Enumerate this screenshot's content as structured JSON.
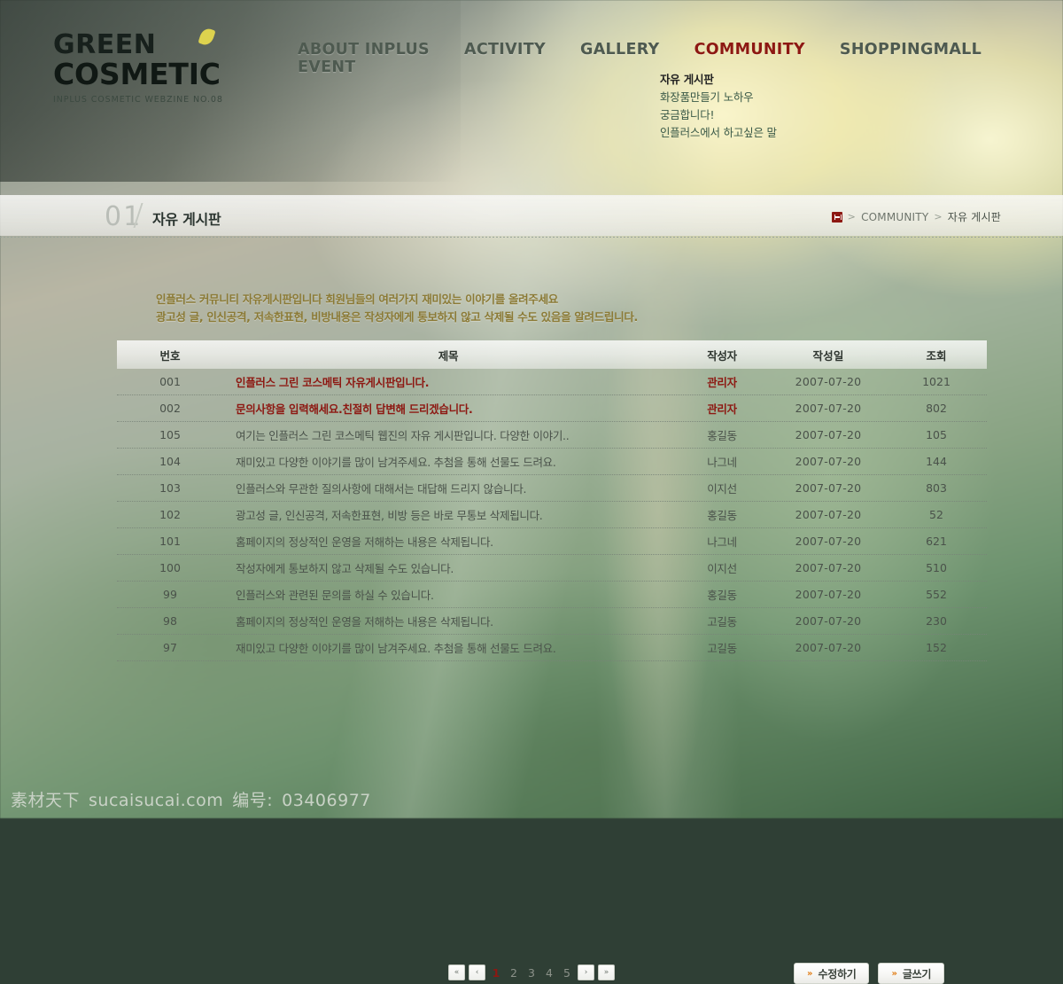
{
  "site": {
    "logo_line1": "GREEN",
    "logo_line2": "COSMETIC",
    "logo_subtitle": "INPLUS COSMETIC WEBZINE NO.08",
    "leaf_color": "#ddd24e"
  },
  "nav": {
    "items": [
      {
        "label": "ABOUT INPLUS",
        "active": false
      },
      {
        "label": "ACTIVITY",
        "active": false
      },
      {
        "label": "GALLERY",
        "active": false
      },
      {
        "label": "COMMUNITY",
        "active": true
      },
      {
        "label": "SHOPPINGMALL",
        "active": false
      },
      {
        "label": "EVENT",
        "active": false
      }
    ],
    "active_color": "#8d1812",
    "inactive_color": "#4e5a50"
  },
  "submenu": {
    "items": [
      {
        "label": "자유 게시판",
        "active": true
      },
      {
        "label": "화장품만들기 노하우",
        "active": false
      },
      {
        "label": "궁금합니다!",
        "active": false
      },
      {
        "label": "인플러스에서 하고싶은 말",
        "active": false
      }
    ]
  },
  "titlebar": {
    "number": "01",
    "title": "자유 게시판"
  },
  "breadcrumb": {
    "home_icon": "home-icon",
    "separator": ">",
    "items": [
      "COMMUNITY",
      "자유 게시판"
    ]
  },
  "intro": {
    "line1": "인플러스 커뮤니티 자유게시판입니다 회원님들의 여러가지 재미있는 이야기를 올려주세요",
    "line2": "광고성 글, 인신공격, 저속한표현, 비방내용은 작성자에게 통보하지 않고 삭제될 수도 있음을 알려드립니다."
  },
  "board": {
    "columns": [
      "번호",
      "제목",
      "작성자",
      "작성일",
      "조회"
    ],
    "rows": [
      {
        "no": "001",
        "title": "인플러스 그린 코스메틱 자유게시판입니다.",
        "writer": "관리자",
        "date": "2007-07-20",
        "hit": "1021",
        "notice": true
      },
      {
        "no": "002",
        "title": "문의사항을 입력해세요.친절히 답변해 드리겠습니다.",
        "writer": "관리자",
        "date": "2007-07-20",
        "hit": "802",
        "notice": true
      },
      {
        "no": "105",
        "title": "여기는 인플러스 그린 코스메틱 웹진의 자유 게시판입니다. 다양한 이야기..",
        "writer": "홍길동",
        "date": "2007-07-20",
        "hit": "105",
        "notice": false
      },
      {
        "no": "104",
        "title": "재미있고 다양한 이야기를 많이 남겨주세요. 추첨을 통해 선물도 드려요.",
        "writer": "나그네",
        "date": "2007-07-20",
        "hit": "144",
        "notice": false
      },
      {
        "no": "103",
        "title": "인플러스와 무관한 질의사항에 대해서는 대답해 드리지 않습니다.",
        "writer": "이지선",
        "date": "2007-07-20",
        "hit": "803",
        "notice": false
      },
      {
        "no": "102",
        "title": "광고성 글, 인신공격, 저속한표현, 비방 등은 바로 무통보 삭제됩니다.",
        "writer": "홍길동",
        "date": "2007-07-20",
        "hit": "52",
        "notice": false
      },
      {
        "no": "101",
        "title": "홈페이지의 정상적인 운영을 저해하는 내용은 삭제됩니다.",
        "writer": "나그네",
        "date": "2007-07-20",
        "hit": "621",
        "notice": false
      },
      {
        "no": "100",
        "title": "작성자에게 통보하지 않고 삭제될 수도 있습니다.",
        "writer": "이지선",
        "date": "2007-07-20",
        "hit": "510",
        "notice": false
      },
      {
        "no": "99",
        "title": "인플러스와 관련된 문의를 하실 수 있습니다.",
        "writer": "홍길동",
        "date": "2007-07-20",
        "hit": "552",
        "notice": false
      },
      {
        "no": "98",
        "title": "홈페이지의 정상적인 운영을 저해하는 내용은 삭제됩니다.",
        "writer": "고길동",
        "date": "2007-07-20",
        "hit": "230",
        "notice": false
      },
      {
        "no": "97",
        "title": "재미있고 다양한 이야기를 많이 남겨주세요. 추첨을 통해 선물도 드려요.",
        "writer": "고길동",
        "date": "2007-07-20",
        "hit": "152",
        "notice": false
      }
    ]
  },
  "pager": {
    "first_label": "«",
    "prev_label": "‹",
    "next_label": "›",
    "last_label": "»",
    "pages": [
      "1",
      "2",
      "3",
      "4",
      "5"
    ],
    "current": "1",
    "active_color": "#8d1812"
  },
  "actions": {
    "arrow": "»",
    "edit_label": "수정하기",
    "write_label": "글쓰기",
    "arrow_color": "#e07b12"
  },
  "watermark": {
    "brand": "素材天下",
    "domain": "sucaisucai.com",
    "id_label": "编号:",
    "id_value": "03406977"
  }
}
